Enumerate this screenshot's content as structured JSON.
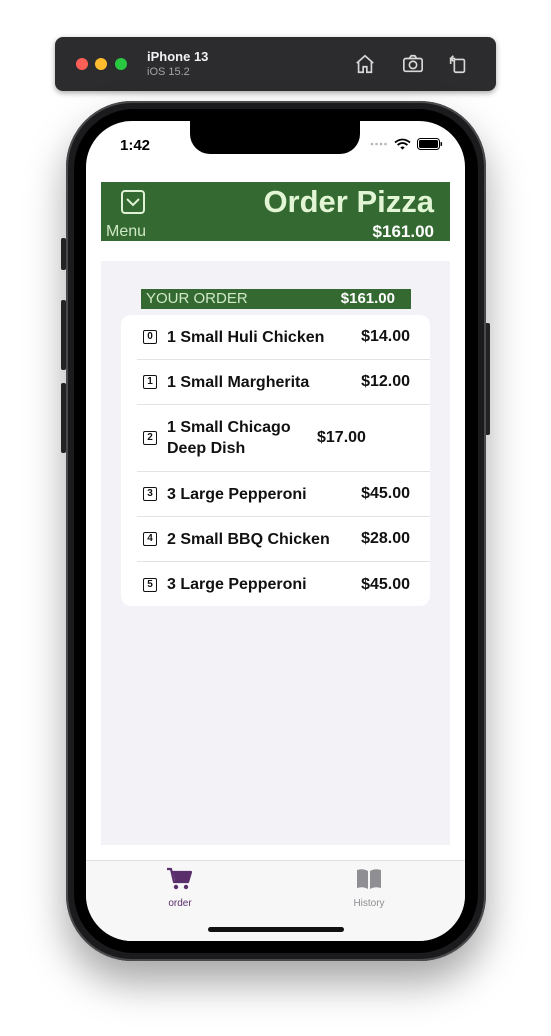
{
  "simulator": {
    "device_name": "iPhone 13",
    "os_version": "iOS 15.2"
  },
  "status_bar": {
    "time": "1:42"
  },
  "header": {
    "title": "Order Pizza",
    "menu_label": "Menu",
    "total": "$161.00"
  },
  "order": {
    "label": "YOUR ORDER",
    "total": "$161.00",
    "items": [
      {
        "index": "0",
        "name": "1 Small Huli Chicken",
        "price": "$14.00"
      },
      {
        "index": "1",
        "name": "1 Small Margherita",
        "price": "$12.00"
      },
      {
        "index": "2",
        "name": "1 Small Chicago Deep Dish",
        "price": "$17.00"
      },
      {
        "index": "3",
        "name": "3 Large Pepperoni",
        "price": "$45.00"
      },
      {
        "index": "4",
        "name": "2 Small BBQ Chicken",
        "price": "$28.00"
      },
      {
        "index": "5",
        "name": "3 Large Pepperoni",
        "price": "$45.00"
      }
    ]
  },
  "tabs": [
    {
      "label": "order",
      "icon": "cart-icon",
      "active": true
    },
    {
      "label": "History",
      "icon": "book-icon",
      "active": false
    }
  ],
  "colors": {
    "header_green": "#346a31",
    "active_tab": "#5a2d6b",
    "inactive_tab": "#8e8e93"
  }
}
